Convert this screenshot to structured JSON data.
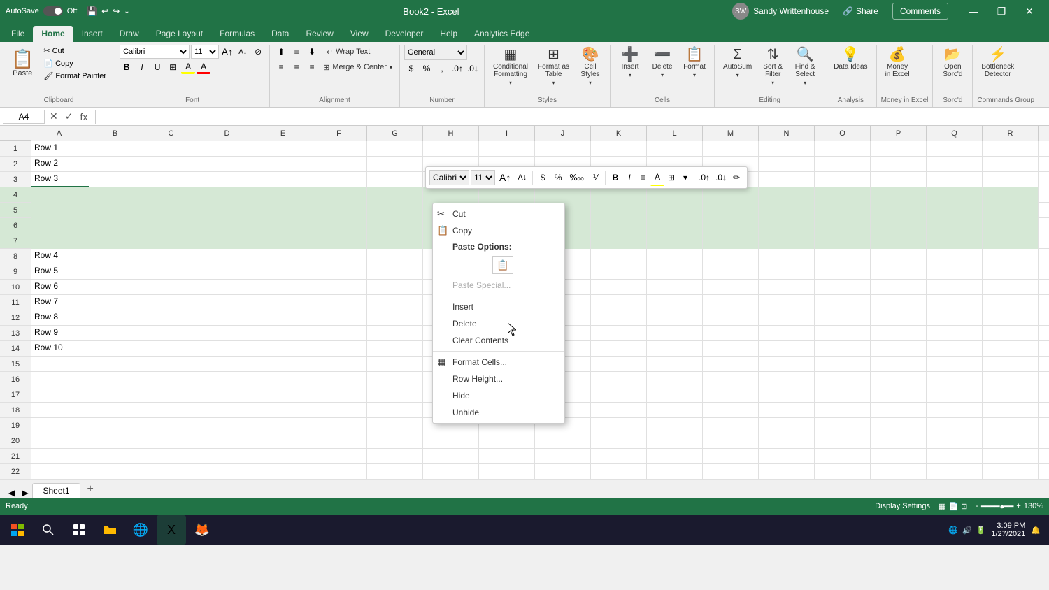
{
  "titlebar": {
    "autosave_label": "AutoSave",
    "autosave_state": "Off",
    "filename": "Book2 - Excel",
    "user_name": "Sandy Writtenhouse",
    "undo_icon": "↩",
    "redo_icon": "↪",
    "save_icon": "💾",
    "minimize": "—",
    "restore": "❐",
    "close": "✕",
    "share_label": "Share",
    "comments_label": "Comments"
  },
  "ribbon_tabs": [
    "File",
    "Home",
    "Insert",
    "Draw",
    "Page Layout",
    "Formulas",
    "Data",
    "Review",
    "View",
    "Developer",
    "Help",
    "Analytics Edge"
  ],
  "active_tab": "Home",
  "ribbon": {
    "clipboard": {
      "label": "Clipboard",
      "paste_label": "Paste",
      "cut_label": "Cut",
      "copy_label": "Copy",
      "format_painter_label": "Format Painter"
    },
    "font": {
      "label": "Font",
      "font_name": "Calibri",
      "font_size": "11",
      "bold": "B",
      "italic": "I",
      "underline": "U"
    },
    "alignment": {
      "label": "Alignment",
      "wrap_text": "Wrap Text",
      "merge_center": "Merge & Center"
    },
    "number": {
      "label": "Number",
      "format": "General"
    },
    "styles": {
      "label": "Styles",
      "conditional_formatting": "Conditional Formatting",
      "format_as_table": "Format as Table",
      "cell_styles": "Cell Styles"
    },
    "cells": {
      "label": "Cells",
      "insert": "Insert",
      "delete": "Delete",
      "format": "Format"
    },
    "editing": {
      "label": "Editing",
      "sort_filter": "Sort & Filter",
      "find_select": "Find & Select"
    },
    "analysis": {
      "label": "Analysis",
      "data_ideas": "Data Ideas"
    },
    "money_in_excel": {
      "label": "Money in Excel",
      "btn": "Money in Excel"
    },
    "sorcd": {
      "label": "Sorc'd",
      "btn": "Open Sorc'd"
    },
    "commands": {
      "label": "Commands Group",
      "bottleneck": "Bottleneck Detector"
    }
  },
  "formula_bar": {
    "cell_ref": "A4",
    "formula": ""
  },
  "columns": [
    "A",
    "B",
    "C",
    "D",
    "E",
    "F",
    "G",
    "H",
    "I",
    "J",
    "K",
    "L",
    "M",
    "N",
    "O",
    "P",
    "Q",
    "R"
  ],
  "rows": [
    {
      "num": 1,
      "data": [
        "Row 1",
        "",
        "",
        "",
        "",
        "",
        "",
        "",
        "",
        "",
        "",
        "",
        "",
        "",
        "",
        "",
        "",
        ""
      ]
    },
    {
      "num": 2,
      "data": [
        "Row 2",
        "",
        "",
        "",
        "",
        "",
        "",
        "",
        "",
        "",
        "",
        "",
        "",
        "",
        "",
        "",
        "",
        ""
      ]
    },
    {
      "num": 3,
      "data": [
        "Row 3",
        "",
        "",
        "",
        "",
        "",
        "",
        "",
        "",
        "",
        "",
        "",
        "",
        "",
        "",
        "",
        "",
        ""
      ]
    },
    {
      "num": 4,
      "data": [
        "",
        "",
        "",
        "",
        "",
        "",
        "",
        "",
        "",
        "",
        "",
        "",
        "",
        "",
        "",
        "",
        "",
        ""
      ]
    },
    {
      "num": 5,
      "data": [
        "",
        "",
        "",
        "",
        "",
        "",
        "",
        "",
        "",
        "",
        "",
        "",
        "",
        "",
        "",
        "",
        "",
        ""
      ]
    },
    {
      "num": 6,
      "data": [
        "",
        "",
        "",
        "",
        "",
        "",
        "",
        "",
        "",
        "",
        "",
        "",
        "",
        "",
        "",
        "",
        "",
        ""
      ]
    },
    {
      "num": 7,
      "data": [
        "",
        "",
        "",
        "",
        "",
        "",
        "",
        "",
        "",
        "",
        "",
        "",
        "",
        "",
        "",
        "",
        "",
        ""
      ]
    },
    {
      "num": 8,
      "data": [
        "Row 4",
        "",
        "",
        "",
        "",
        "",
        "",
        "",
        "",
        "",
        "",
        "",
        "",
        "",
        "",
        "",
        "",
        ""
      ]
    },
    {
      "num": 9,
      "data": [
        "Row 5",
        "",
        "",
        "",
        "",
        "",
        "",
        "",
        "",
        "",
        "",
        "",
        "",
        "",
        "",
        "",
        "",
        ""
      ]
    },
    {
      "num": 10,
      "data": [
        "Row 6",
        "",
        "",
        "",
        "",
        "",
        "",
        "",
        "",
        "",
        "",
        "",
        "",
        "",
        "",
        "",
        "",
        ""
      ]
    },
    {
      "num": 11,
      "data": [
        "Row 7",
        "",
        "",
        "",
        "",
        "",
        "",
        "",
        "",
        "",
        "",
        "",
        "",
        "",
        "",
        "",
        "",
        ""
      ]
    },
    {
      "num": 12,
      "data": [
        "Row 8",
        "",
        "",
        "",
        "",
        "",
        "",
        "",
        "",
        "",
        "",
        "",
        "",
        "",
        "",
        "",
        "",
        ""
      ]
    },
    {
      "num": 13,
      "data": [
        "Row 9",
        "",
        "",
        "",
        "",
        "",
        "",
        "",
        "",
        "",
        "",
        "",
        "",
        "",
        "",
        "",
        "",
        ""
      ]
    },
    {
      "num": 14,
      "data": [
        "Row 10",
        "",
        "",
        "",
        "",
        "",
        "",
        "",
        "",
        "",
        "",
        "",
        "",
        "",
        "",
        "",
        "",
        ""
      ]
    },
    {
      "num": 15,
      "data": [
        "",
        "",
        "",
        "",
        "",
        "",
        "",
        "",
        "",
        "",
        "",
        "",
        "",
        "",
        "",
        "",
        "",
        ""
      ]
    },
    {
      "num": 16,
      "data": [
        "",
        "",
        "",
        "",
        "",
        "",
        "",
        "",
        "",
        "",
        "",
        "",
        "",
        "",
        "",
        "",
        "",
        ""
      ]
    },
    {
      "num": 17,
      "data": [
        "",
        "",
        "",
        "",
        "",
        "",
        "",
        "",
        "",
        "",
        "",
        "",
        "",
        "",
        "",
        "",
        "",
        ""
      ]
    },
    {
      "num": 18,
      "data": [
        "",
        "",
        "",
        "",
        "",
        "",
        "",
        "",
        "",
        "",
        "",
        "",
        "",
        "",
        "",
        "",
        "",
        ""
      ]
    },
    {
      "num": 19,
      "data": [
        "",
        "",
        "",
        "",
        "",
        "",
        "",
        "",
        "",
        "",
        "",
        "",
        "",
        "",
        "",
        "",
        "",
        ""
      ]
    },
    {
      "num": 20,
      "data": [
        "",
        "",
        "",
        "",
        "",
        "",
        "",
        "",
        "",
        "",
        "",
        "",
        "",
        "",
        "",
        "",
        "",
        ""
      ]
    },
    {
      "num": 21,
      "data": [
        "",
        "",
        "",
        "",
        "",
        "",
        "",
        "",
        "",
        "",
        "",
        "",
        "",
        "",
        "",
        "",
        "",
        ""
      ]
    },
    {
      "num": 22,
      "data": [
        "",
        "",
        "",
        "",
        "",
        "",
        "",
        "",
        "",
        "",
        "",
        "",
        "",
        "",
        "",
        "",
        "",
        ""
      ]
    }
  ],
  "selected_rows": [
    4,
    5,
    6,
    7
  ],
  "context_menu": {
    "items": [
      {
        "id": "cut",
        "label": "Cut",
        "icon": "✂",
        "enabled": true
      },
      {
        "id": "copy",
        "label": "Copy",
        "icon": "📋",
        "enabled": true
      },
      {
        "id": "paste_options_label",
        "label": "Paste Options:",
        "type": "section"
      },
      {
        "id": "paste_options",
        "type": "paste_options"
      },
      {
        "id": "paste_special",
        "label": "Paste Special...",
        "icon": "",
        "enabled": false
      },
      {
        "id": "sep1",
        "type": "divider"
      },
      {
        "id": "insert",
        "label": "Insert",
        "icon": "",
        "enabled": true
      },
      {
        "id": "delete",
        "label": "Delete",
        "icon": "",
        "enabled": true
      },
      {
        "id": "clear_contents",
        "label": "Clear Contents",
        "icon": "",
        "enabled": true
      },
      {
        "id": "sep2",
        "type": "divider"
      },
      {
        "id": "format_cells",
        "label": "Format Cells...",
        "icon": "▦",
        "enabled": true
      },
      {
        "id": "row_height",
        "label": "Row Height...",
        "icon": "",
        "enabled": true
      },
      {
        "id": "hide",
        "label": "Hide",
        "icon": "",
        "enabled": true
      },
      {
        "id": "unhide",
        "label": "Unhide",
        "icon": "",
        "enabled": true
      }
    ]
  },
  "mini_toolbar": {
    "font_name": "Calibri",
    "font_size": "11"
  },
  "sheet_tabs": [
    "Sheet1"
  ],
  "status": {
    "ready": "Ready",
    "display_settings": "Display Settings",
    "zoom": "130%"
  },
  "taskbar": {
    "time": "3:09 PM",
    "date": "1/27/2021"
  }
}
